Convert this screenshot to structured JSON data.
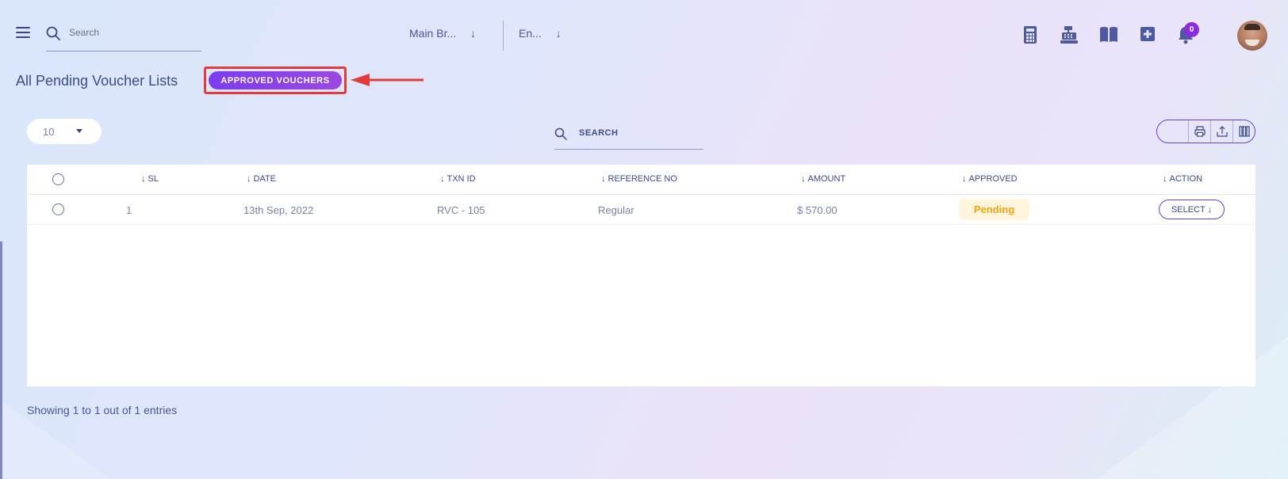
{
  "header": {
    "search_placeholder": "Search",
    "branch_label": "Main Br...",
    "language_label": "En...",
    "dropdown_arrow": "↓",
    "notification_count": "0",
    "icons": [
      "calculator-icon",
      "cash-register-icon",
      "book-icon",
      "plus-square-icon",
      "bell-icon"
    ]
  },
  "page": {
    "title": "All Pending Voucher Lists",
    "approved_button": "APPROVED VOUCHERS",
    "annotation_color": "#e23b3b"
  },
  "toolbar": {
    "page_length": "10",
    "search_placeholder": "SEARCH",
    "export_icons": [
      "print-icon",
      "export-icon",
      "columns-icon"
    ]
  },
  "table": {
    "sort_arrow": "↓",
    "columns": [
      "SL",
      "DATE",
      "TXN ID",
      "REFERENCE NO",
      "AMOUNT",
      "APPROVED",
      "ACTION"
    ],
    "rows": [
      {
        "sl": "1",
        "date": "13th Sep, 2022",
        "txn_id": "RVC - 105",
        "reference_no": "Regular",
        "amount": "$ 570.00",
        "approved": "Pending",
        "action": "SELECT ↓"
      }
    ]
  },
  "footer": {
    "info": "Showing 1 to 1 out of 1 entries"
  },
  "colors": {
    "accent": "#7d3cf0",
    "text": "#3d4a8a",
    "pending_text": "#f3a50f",
    "pending_bg": "#fff4dc",
    "badge": "#8a2be2"
  }
}
